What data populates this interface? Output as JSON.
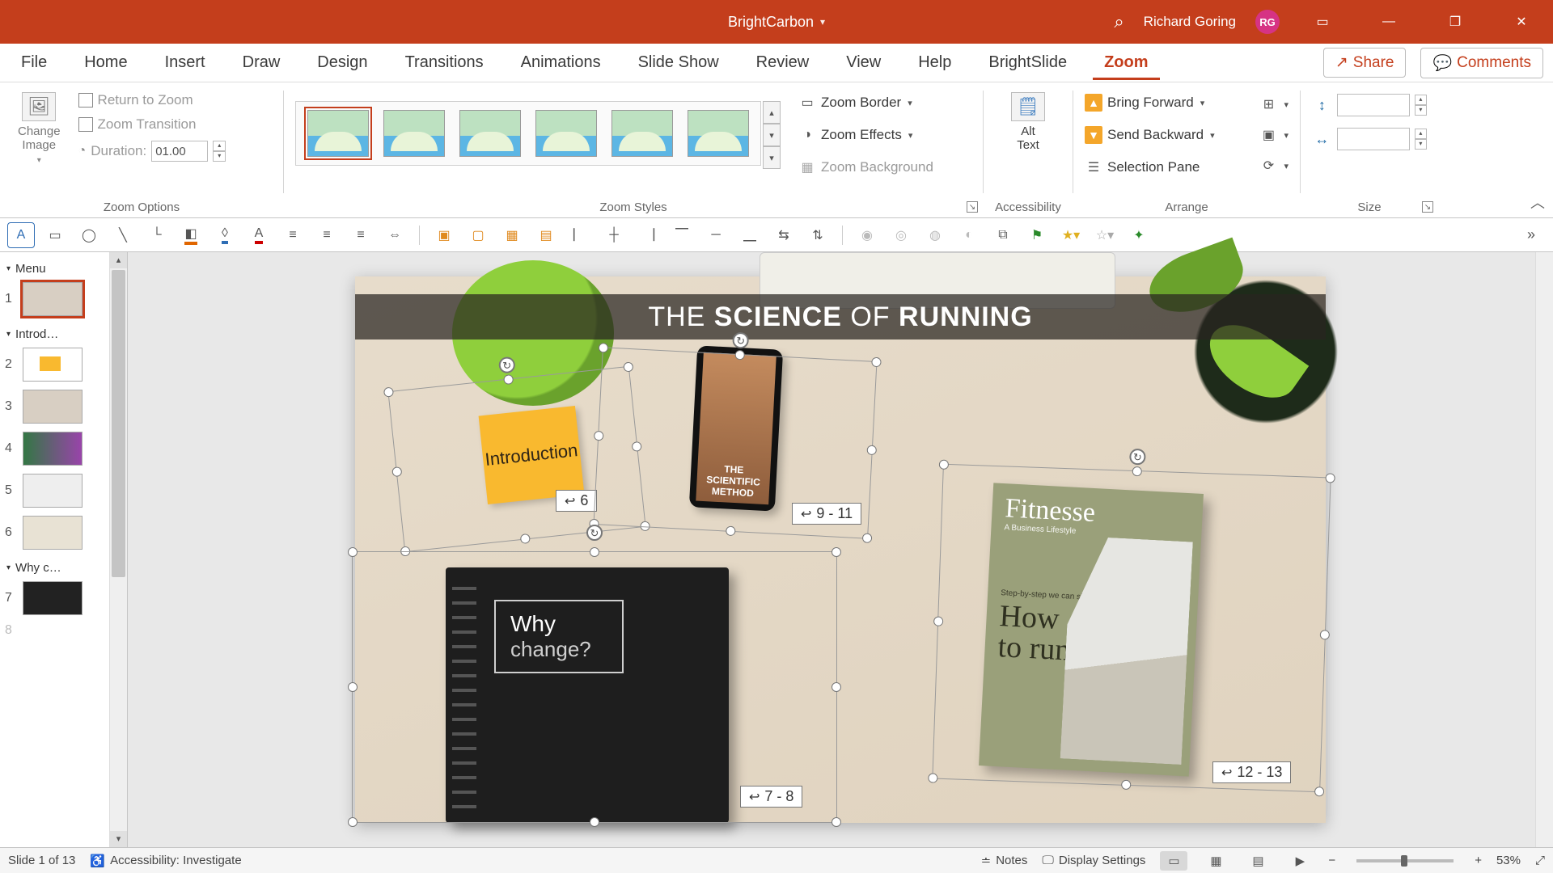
{
  "titlebar": {
    "doc_name": "BrightCarbon",
    "user_name": "Richard Goring",
    "user_initials": "RG"
  },
  "tabs": {
    "items": [
      "File",
      "Home",
      "Insert",
      "Draw",
      "Design",
      "Transitions",
      "Animations",
      "Slide Show",
      "Review",
      "View",
      "Help",
      "BrightSlide",
      "Zoom"
    ],
    "active": "Zoom",
    "share": "Share",
    "comments": "Comments"
  },
  "ribbon": {
    "change_image": "Change\nImage",
    "return_to_zoom": "Return to Zoom",
    "zoom_transition": "Zoom Transition",
    "duration_label": "Duration:",
    "duration_value": "01.00",
    "zoom_border": "Zoom Border",
    "zoom_effects": "Zoom Effects",
    "zoom_background": "Zoom Background",
    "alt_text": "Alt\nText",
    "bring_forward": "Bring Forward",
    "send_backward": "Send Backward",
    "selection_pane": "Selection Pane",
    "groups": {
      "zoom_options": "Zoom Options",
      "zoom_styles": "Zoom Styles",
      "accessibility": "Accessibility",
      "arrange": "Arrange",
      "size": "Size"
    }
  },
  "sections": [
    {
      "title": "Menu",
      "slides": [
        1
      ]
    },
    {
      "title": "Introd…",
      "slides": [
        2,
        3,
        4,
        5,
        6
      ]
    },
    {
      "title": "Why c…",
      "slides": [
        7,
        8
      ]
    }
  ],
  "slide": {
    "title_pre": "THE ",
    "title_bold1": "SCIENCE",
    "title_mid": " OF ",
    "title_bold2": "RUNNING",
    "sticky": "Introduction",
    "phone_l1": "THE",
    "phone_l2": "SCIENTIFIC",
    "phone_l3": "METHOD",
    "notebook_l1": "Why",
    "notebook_l2": "change?",
    "mag_masthead": "Fitnesse",
    "mag_sub": "A Business Lifestyle",
    "mag_kicker": "Step-by-step we can show you",
    "mag_head": "How\nto run",
    "tags": {
      "sticky": "6",
      "phone": "9 - 11",
      "notebook": "7 - 8",
      "mag": "12 - 13"
    }
  },
  "status": {
    "slide_counter": "Slide 1 of 13",
    "accessibility": "Accessibility: Investigate",
    "notes": "Notes",
    "display_settings": "Display Settings",
    "zoom_pct": "53%"
  }
}
